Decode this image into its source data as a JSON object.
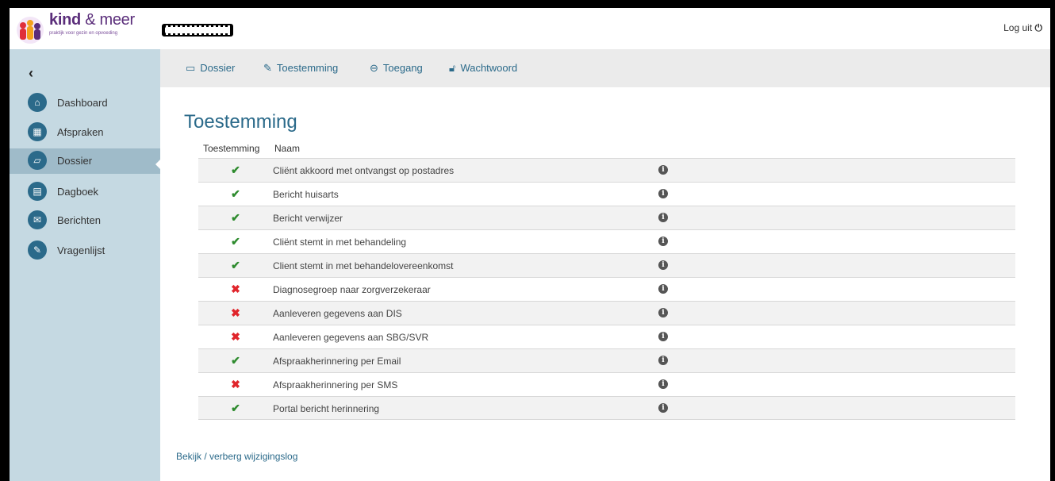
{
  "header": {
    "brand_name": "kind",
    "brand_amp": "& meer",
    "brand_tagline": "praktijk voor gezin en opvoeding",
    "logout_label": "Log uit"
  },
  "sidebar": {
    "back_icon": "chevron-left-icon",
    "items": [
      {
        "label": "Dashboard",
        "icon": "home-icon"
      },
      {
        "label": "Afspraken",
        "icon": "calendar-icon"
      },
      {
        "label": "Dossier",
        "icon": "folder-icon",
        "active": true
      },
      {
        "label": "Dagboek",
        "icon": "book-icon"
      },
      {
        "label": "Berichten",
        "icon": "envelope-icon"
      },
      {
        "label": "Vragenlijst",
        "icon": "edit-icon"
      }
    ]
  },
  "subnav": {
    "items": [
      {
        "label": "Dossier",
        "icon": "folder-icon"
      },
      {
        "label": "Toestemming",
        "icon": "edit-icon"
      },
      {
        "label": "Toegang",
        "icon": "minus-circle-icon"
      },
      {
        "label": "Wachtwoord",
        "icon": "unlock-icon"
      }
    ]
  },
  "main": {
    "title": "Toestemming",
    "columns": {
      "consent": "Toestemming",
      "name": "Naam"
    },
    "rows": [
      {
        "consent": "yes",
        "name": "Cliënt akkoord met ontvangst op postadres"
      },
      {
        "consent": "yes",
        "name": "Bericht huisarts"
      },
      {
        "consent": "yes",
        "name": "Bericht verwijzer"
      },
      {
        "consent": "yes",
        "name": "Cliënt stemt in met behandeling"
      },
      {
        "consent": "yes",
        "name": "Client stemt in met behandelovereenkomst"
      },
      {
        "consent": "no",
        "name": "Diagnosegroep naar zorgverzekeraar"
      },
      {
        "consent": "no",
        "name": "Aanleveren gegevens aan DIS"
      },
      {
        "consent": "no",
        "name": "Aanleveren gegevens aan SBG/SVR"
      },
      {
        "consent": "yes",
        "name": "Afspraakherinnering per Email"
      },
      {
        "consent": "no",
        "name": "Afspraakherinnering per SMS"
      },
      {
        "consent": "yes",
        "name": "Portal bericht herinnering"
      }
    ],
    "log_link": "Bekijk / verberg wijzigingslog"
  },
  "colors": {
    "accent": "#2b6a8a",
    "sidebar_bg": "#c5d9e2",
    "check": "#2e8b2e",
    "cross": "#e0252b"
  }
}
